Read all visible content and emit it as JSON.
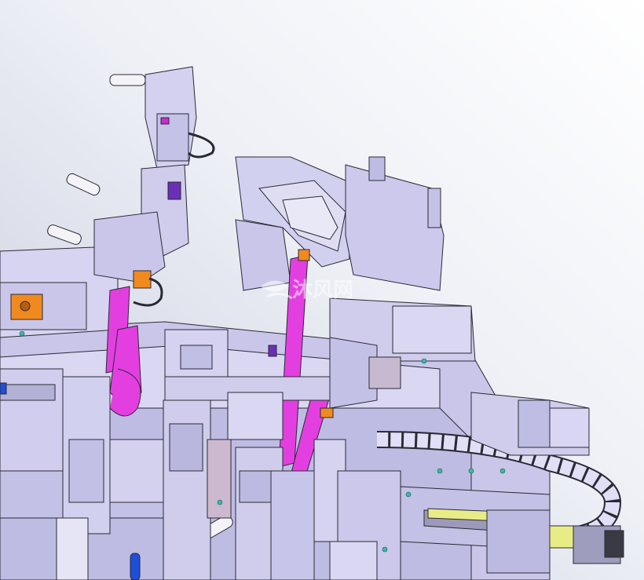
{
  "watermark": {
    "text": "沐风网",
    "icon": "wind-logo-icon"
  },
  "colors": {
    "bg_light": "#ffffff",
    "bg_dark": "#c9cbe0",
    "metal": "#cfcdeb",
    "metal_mid": "#b4b1d6",
    "metal_dark": "#6e6c8a",
    "edge": "#2a2a35",
    "magenta": "#e33fe0",
    "orange": "#f08a1f",
    "purple": "#6b2fb5",
    "blue": "#1d4fd8",
    "teal": "#3fb6a6",
    "yellow": "#e8ec86"
  }
}
